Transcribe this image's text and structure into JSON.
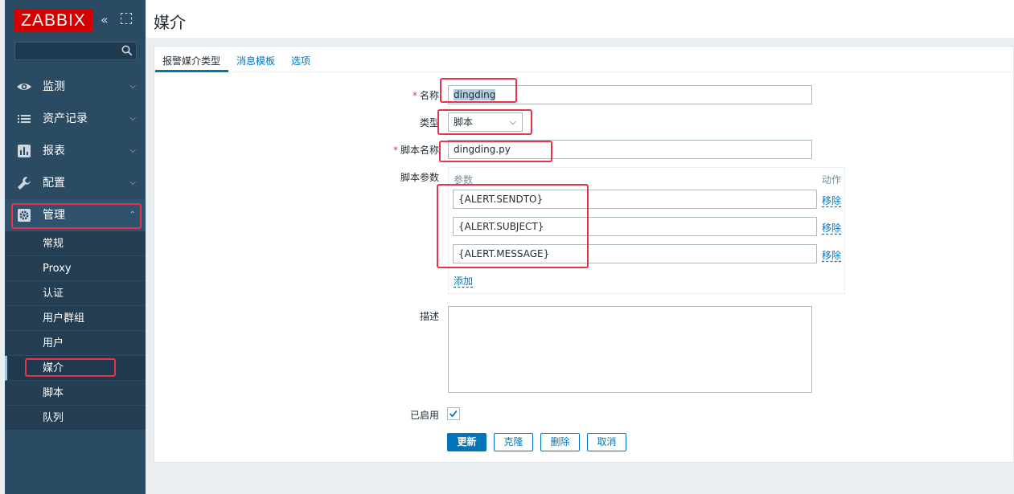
{
  "app": {
    "logo": "ZABBIX",
    "search_placeholder": ""
  },
  "sidebar": {
    "items": [
      {
        "label": "监测",
        "icon": "eye-icon"
      },
      {
        "label": "资产记录",
        "icon": "list-icon"
      },
      {
        "label": "报表",
        "icon": "chart-icon"
      },
      {
        "label": "配置",
        "icon": "wrench-icon"
      },
      {
        "label": "管理",
        "icon": "gear-icon"
      }
    ],
    "admin_submenu": [
      "常规",
      "Proxy",
      "认证",
      "用户群组",
      "用户",
      "媒介",
      "脚本",
      "队列"
    ]
  },
  "header": {
    "title": "媒介"
  },
  "tabs": [
    "报警媒介类型",
    "消息模板",
    "选项"
  ],
  "form": {
    "name_label": "名称",
    "name_value": "dingding",
    "type_label": "类型",
    "type_value": "脚本",
    "script_name_label": "脚本名称",
    "script_name_value": "dingding.py",
    "script_params_label": "脚本参数",
    "params_col_header": "参数",
    "action_col_header": "动作",
    "params": [
      {
        "value": "{ALERT.SENDTO}",
        "remove": "移除"
      },
      {
        "value": "{ALERT.SUBJECT}",
        "remove": "移除"
      },
      {
        "value": "{ALERT.MESSAGE}",
        "remove": "移除"
      }
    ],
    "add_label": "添加",
    "description_label": "描述",
    "description_value": "",
    "enabled_label": "已启用",
    "enabled": true
  },
  "buttons": {
    "update": "更新",
    "clone": "克隆",
    "delete": "删除",
    "cancel": "取消"
  },
  "colors": {
    "sidebar": "#2b4b63",
    "accent": "#0275b8",
    "logo": "#d40000",
    "highlight": "#e8334a"
  }
}
